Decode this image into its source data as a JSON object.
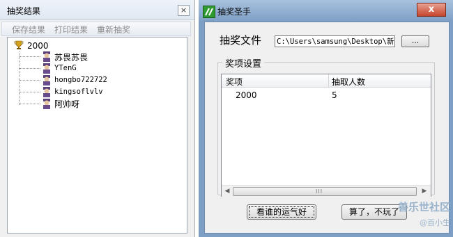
{
  "left_window": {
    "title": "抽奖结果",
    "close_label": "×",
    "menu": [
      "保存结果",
      "打印结果",
      "重新抽奖"
    ],
    "tree": {
      "root": "2000",
      "children": [
        "苏畏苏畏",
        "YTenG",
        "hongbo722722",
        "kingsoflvlv",
        "阿帅呀"
      ]
    }
  },
  "right_window": {
    "title": "抽奖圣手",
    "close_label": "x",
    "file_label": "抽奖文件",
    "file_path": "C:\\Users\\samsung\\Desktop\\新建",
    "browse_label": "...",
    "group_title": "奖项设置",
    "columns": [
      "奖项",
      "抽取人数"
    ],
    "rows": [
      {
        "prize": "2000",
        "count": "5"
      }
    ],
    "grip": "III",
    "buttons": {
      "lucky": "看谁的运气好",
      "quit": "算了，不玩了"
    }
  },
  "watermark": {
    "main": "善乐世社区",
    "sub": "@百小生"
  },
  "colors": {
    "title_bar": "#7d9ec5",
    "close_red": "#c6452d",
    "app_icon_green": "#2f9a2f"
  }
}
